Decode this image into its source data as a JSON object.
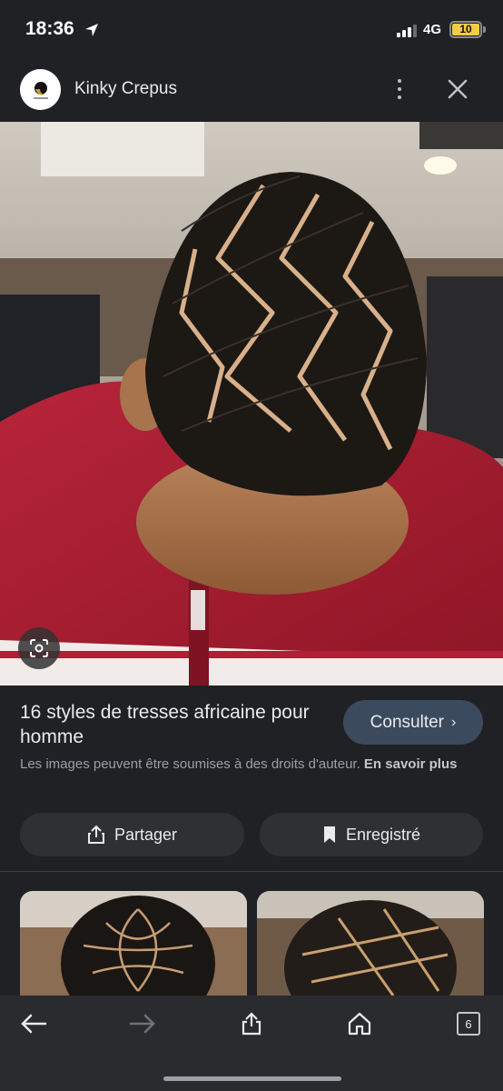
{
  "status_bar": {
    "time": "18:36",
    "network": "4G",
    "battery": "10",
    "battery_color": "#f2cd45",
    "icons": [
      "location-arrow-icon",
      "signal-bars-icon",
      "battery-icon"
    ]
  },
  "header": {
    "site_name": "Kinky Crepus",
    "more_icon": "more-vert-icon",
    "close_icon": "close-icon"
  },
  "image": {
    "lens_icon": "google-lens-icon"
  },
  "info": {
    "title": "16 styles de tresses africaine pour homme",
    "visit_label": "Consulter",
    "visit_icon": "chevron-right-icon",
    "copyright_text": "Les images peuvent être soumises à des droits d'auteur.",
    "learn_more": "En savoir plus"
  },
  "actions": {
    "share_label": "Partager",
    "share_icon": "share-icon",
    "save_label": "Enregistré",
    "save_icon": "bookmark-icon"
  },
  "toolbar": {
    "icons": [
      "back-arrow-icon",
      "forward-arrow-icon",
      "share-icon",
      "home-icon",
      "tabs-icon"
    ],
    "tab_count": "6"
  },
  "colors": {
    "background": "#202124",
    "button_accent": "#3c4a5e",
    "shirt_red": "#a51e2d"
  }
}
